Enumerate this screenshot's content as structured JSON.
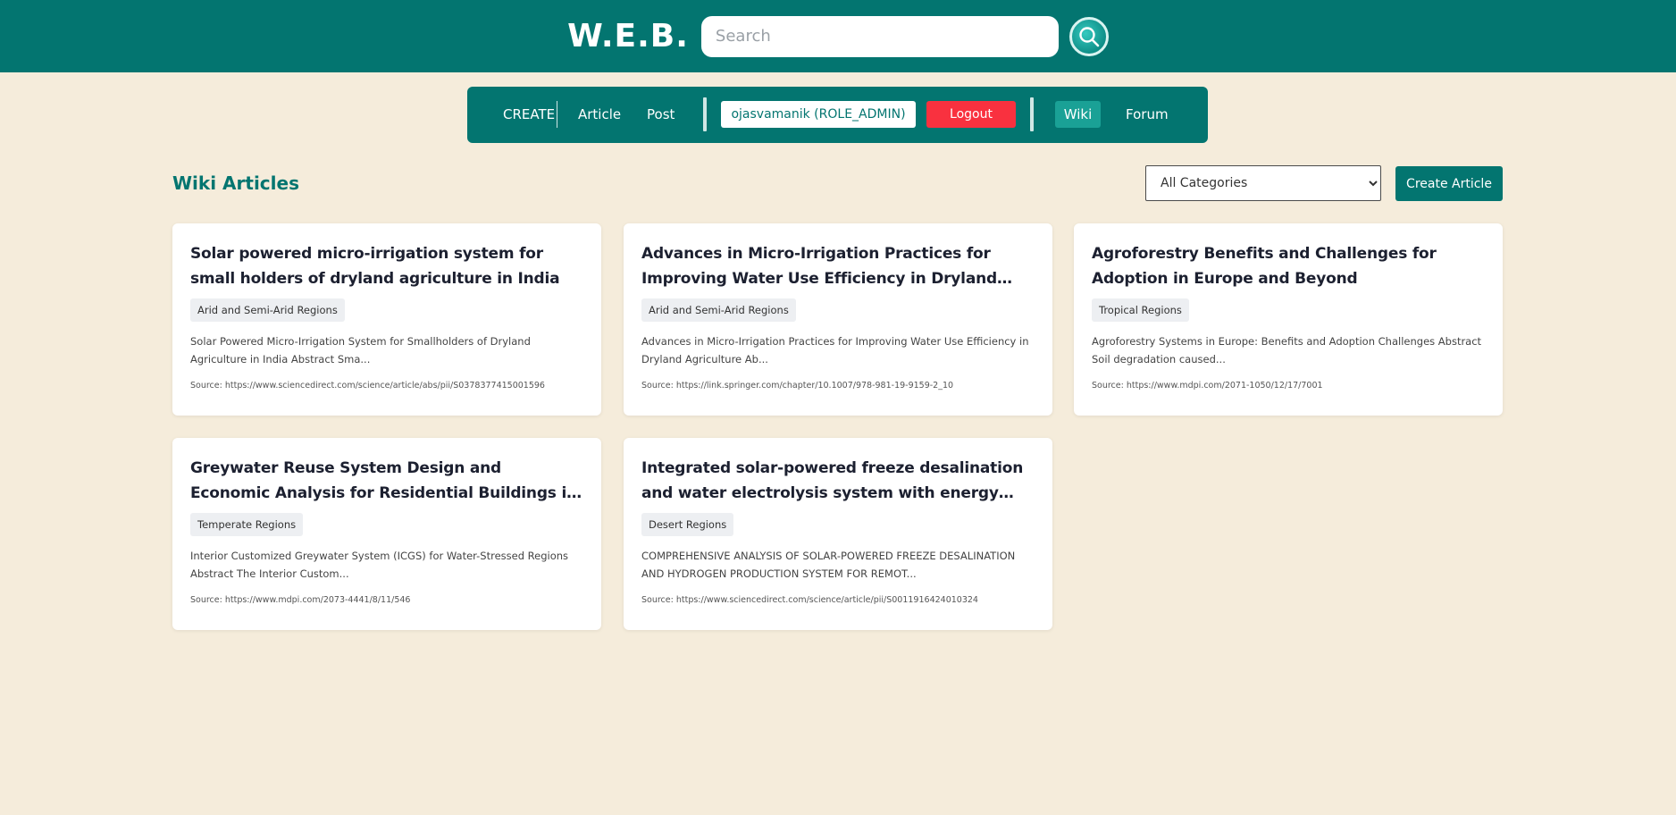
{
  "header": {
    "brand": "W.E.B.",
    "search_placeholder": "Search",
    "search_icon": "search-icon"
  },
  "nav": {
    "create_label": "CREATE",
    "article_link": "Article",
    "post_link": "Post",
    "user_badge": "ojasvamanik (ROLE_ADMIN)",
    "logout_label": "Logout",
    "wiki_label": "Wiki",
    "forum_label": "Forum"
  },
  "main": {
    "title": "Wiki Articles",
    "category_selected": "All Categories",
    "create_article_label": "Create Article",
    "cards": [
      {
        "title": "Solar powered micro-irrigation system for small holders of dryland agriculture in India",
        "tag": "Arid and Semi-Arid Regions",
        "excerpt": "Solar Powered Micro-Irrigation System for Smallholders of Dryland Agriculture in India Abstract Sma...",
        "source": "Source: https://www.sciencedirect.com/science/article/abs/pii/S0378377415001596"
      },
      {
        "title": "Advances in Micro-Irrigation Practices for Improving Water Use Efficiency in Dryland Agriculture",
        "tag": "Arid and Semi-Arid Regions",
        "excerpt": "Advances in Micro-Irrigation Practices for Improving Water Use Efficiency in Dryland Agriculture Ab...",
        "source": "Source: https://link.springer.com/chapter/10.1007/978-981-19-9159-2_10"
      },
      {
        "title": "Agroforestry Benefits and Challenges for Adoption in Europe and Beyond",
        "tag": "Tropical Regions",
        "excerpt": "Agroforestry Systems in Europe: Benefits and Adoption Challenges Abstract Soil degradation caused...",
        "source": "Source: https://www.mdpi.com/2071-1050/12/17/7001"
      },
      {
        "title": "Greywater Reuse System Design and Economic Analysis for Residential Buildings in Taiwan",
        "tag": "Temperate Regions",
        "excerpt": "Interior Customized Greywater System (ICGS) for Water-Stressed Regions Abstract The Interior Custom...",
        "source": "Source: https://www.mdpi.com/2073-4441/8/11/546"
      },
      {
        "title": "Integrated solar-powered freeze desalination and water electrolysis system with energy recovery and…",
        "tag": "Desert Regions",
        "excerpt": "COMPREHENSIVE ANALYSIS OF SOLAR-POWERED FREEZE DESALINATION AND HYDROGEN PRODUCTION SYSTEM FOR REMOT...",
        "source": "Source: https://www.sciencedirect.com/science/article/pii/S0011916424010324"
      }
    ]
  }
}
